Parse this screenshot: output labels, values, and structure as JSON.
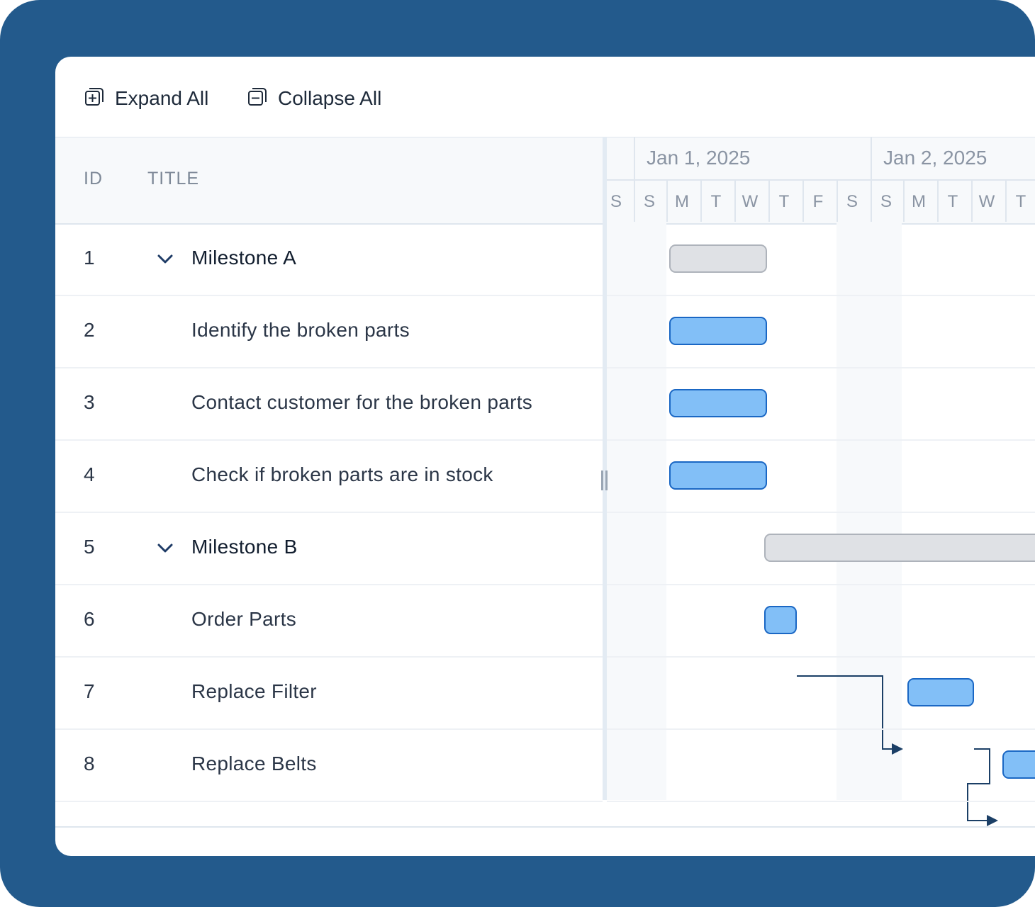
{
  "toolbar": {
    "expand_label": "Expand All",
    "collapse_label": "Collapse All"
  },
  "columns": {
    "id_header": "ID",
    "title_header": "TITLE"
  },
  "timeline": {
    "dates": [
      "Jan 1, 2025",
      "Jan 2, 2025"
    ],
    "days": [
      "S",
      "S",
      "M",
      "T",
      "W",
      "T",
      "F",
      "S",
      "S",
      "M",
      "T",
      "W",
      "T"
    ]
  },
  "rows": [
    {
      "id": "1",
      "title": "Milestone A",
      "type": "milestone"
    },
    {
      "id": "2",
      "title": "Identify the broken parts",
      "type": "task"
    },
    {
      "id": "3",
      "title": "Contact customer for the broken parts",
      "type": "task"
    },
    {
      "id": "4",
      "title": "Check if broken parts are in stock",
      "type": "task"
    },
    {
      "id": "5",
      "title": "Milestone B",
      "type": "milestone"
    },
    {
      "id": "6",
      "title": "Order Parts",
      "type": "task"
    },
    {
      "id": "7",
      "title": "Replace Filter",
      "type": "task"
    },
    {
      "id": "8",
      "title": "Replace Belts",
      "type": "task"
    }
  ],
  "colors": {
    "frame": "#235a8c",
    "task_fill": "#82bff7",
    "task_border": "#1a67c4",
    "milestone_fill": "#dfe1e5",
    "dependency_line": "#1b3f66"
  },
  "icons": {
    "expand": "expand-all-icon",
    "collapse": "collapse-all-icon",
    "row_toggle": "chevron-down-icon"
  }
}
